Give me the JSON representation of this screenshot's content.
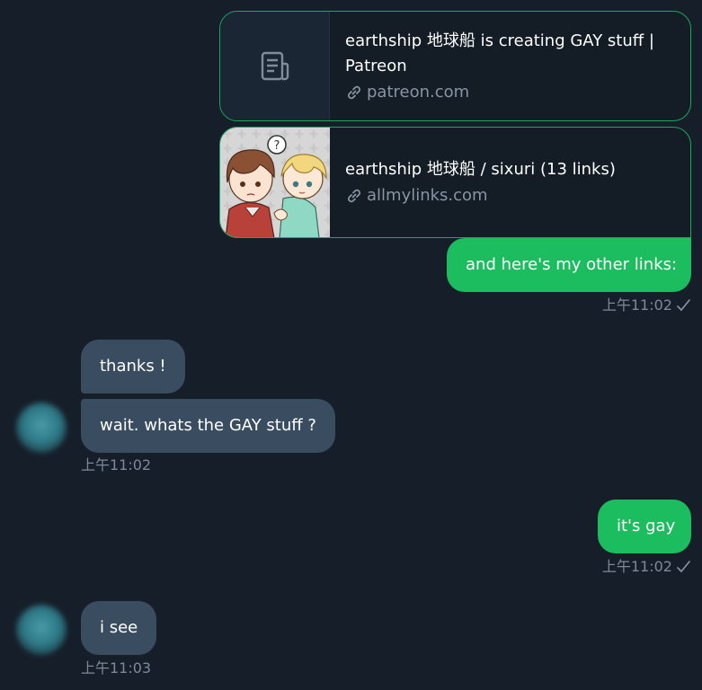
{
  "cards": {
    "patreon": {
      "title_line1": "earthship 地球船 is creating GAY stuff |",
      "title_line2": "Patreon",
      "domain": "patreon.com",
      "thumb_icon": "document-icon"
    },
    "allmylinks": {
      "title": "earthship 地球船 / sixuri (13 links)",
      "domain": "allmylinks.com",
      "thumb_icon": "illustration-thumbnail"
    }
  },
  "messages": {
    "out1": {
      "text": "and here's my other links:",
      "time": "上午11:02",
      "status": "sent-check"
    },
    "in1": {
      "text": "thanks !"
    },
    "in2": {
      "text": "wait. whats the GAY stuff ?",
      "time": "上午11:02"
    },
    "out2": {
      "text": "it's gay",
      "time": "上午11:02",
      "status": "sent-check"
    },
    "in3": {
      "text": "i see",
      "time": "上午11:03"
    }
  },
  "colors": {
    "background": "#161f29",
    "outgoing_bubble": "#1bbd5e",
    "incoming_bubble": "#3a4c5f",
    "card_border": "#1aa85a",
    "muted_text": "#7d8996"
  }
}
